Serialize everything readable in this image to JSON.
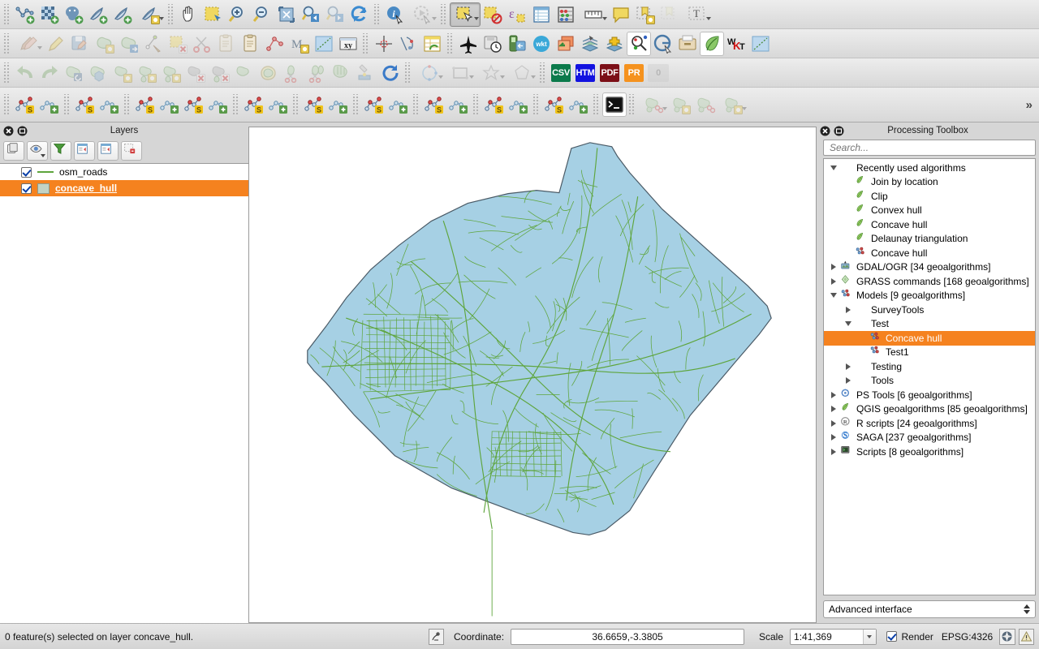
{
  "toolbars": {
    "row1": [
      {
        "name": "add-vector-layer-button",
        "icon": "vector-add-icon",
        "disabled": false
      },
      {
        "name": "add-raster-layer-button",
        "icon": "raster-add-icon",
        "disabled": false
      },
      {
        "name": "add-postgis-layer-button",
        "icon": "postgis-add-icon",
        "disabled": false
      },
      {
        "name": "add-spatialite-layer-button",
        "icon": "spatialite-add-icon",
        "disabled": false
      },
      {
        "name": "add-mssql-layer-button",
        "icon": "mssql-add-icon",
        "disabled": false
      },
      {
        "name": "new-shapefile-layer-button",
        "icon": "new-layer-icon",
        "disabled": false,
        "menu": true
      },
      {
        "name": "pan-map-button",
        "icon": "pan-hand-icon",
        "disabled": false
      },
      {
        "name": "pan-to-selection-button",
        "icon": "pan-selection-icon",
        "disabled": false
      },
      {
        "name": "zoom-in-button",
        "icon": "zoom-in-icon",
        "disabled": false
      },
      {
        "name": "zoom-out-button",
        "icon": "zoom-out-icon",
        "disabled": false
      },
      {
        "name": "zoom-full-button",
        "icon": "zoom-full-icon",
        "disabled": false
      },
      {
        "name": "zoom-last-button",
        "icon": "zoom-last-icon",
        "disabled": false
      },
      {
        "name": "zoom-next-button",
        "icon": "zoom-next-icon",
        "disabled": true
      },
      {
        "name": "refresh-button",
        "icon": "refresh-icon",
        "disabled": false
      },
      {
        "name": "identify-features-button",
        "icon": "identify-icon",
        "disabled": false
      },
      {
        "name": "run-feature-action-button",
        "icon": "feature-action-icon",
        "disabled": true,
        "menu": true
      },
      {
        "name": "select-features-button",
        "icon": "select-rect-icon",
        "disabled": false,
        "active": true,
        "menu": true
      },
      {
        "name": "deselect-features-button",
        "icon": "deselect-icon",
        "disabled": false
      },
      {
        "name": "select-by-expression-button",
        "icon": "expression-select-icon",
        "disabled": false
      },
      {
        "name": "open-attribute-table-button",
        "icon": "attribute-table-icon",
        "disabled": false
      },
      {
        "name": "open-field-calculator-button",
        "icon": "abacus-icon",
        "disabled": false
      },
      {
        "name": "measure-line-button",
        "icon": "ruler-icon",
        "disabled": false,
        "menu": true
      },
      {
        "name": "map-tips-button",
        "icon": "map-tip-icon",
        "disabled": false
      },
      {
        "name": "new-bookmark-button",
        "icon": "bookmark-new-icon",
        "disabled": false
      },
      {
        "name": "show-bookmarks-button",
        "icon": "bookmark-show-icon",
        "disabled": true
      },
      {
        "name": "text-annotation-button",
        "icon": "text-annotation-icon",
        "disabled": false,
        "menu": true
      }
    ],
    "row2": [
      {
        "name": "current-edits-button",
        "icon": "pencils-icon",
        "disabled": true,
        "menu": true
      },
      {
        "name": "toggle-editing-button",
        "icon": "pencil-icon",
        "disabled": true
      },
      {
        "name": "save-layer-edits-button",
        "icon": "save-edits-icon",
        "disabled": true
      },
      {
        "name": "add-feature-button",
        "icon": "add-feature-icon",
        "disabled": true
      },
      {
        "name": "move-feature-button",
        "icon": "move-feature-icon",
        "disabled": true
      },
      {
        "name": "node-tool-button",
        "icon": "node-tool-icon",
        "disabled": true
      },
      {
        "name": "delete-selected-button",
        "icon": "delete-selected-icon",
        "disabled": true
      },
      {
        "name": "cut-features-button",
        "icon": "scissors-icon",
        "disabled": true
      },
      {
        "name": "copy-features-button",
        "icon": "copy-icon",
        "disabled": true
      },
      {
        "name": "paste-features-button",
        "icon": "paste-icon",
        "disabled": false
      },
      {
        "name": "points-to-path-button",
        "icon": "points-path-icon",
        "disabled": false
      },
      {
        "name": "add-node-button",
        "icon": "mmqgis-icon",
        "disabled": false
      },
      {
        "name": "line-tool-button",
        "icon": "line-blue-icon",
        "disabled": false
      },
      {
        "name": "xy-tools-button",
        "icon": "xy-icon",
        "disabled": false
      },
      {
        "name": "crosshair-button",
        "icon": "crosshair-icon",
        "disabled": false
      },
      {
        "name": "vector-bender-button",
        "icon": "vector-bender-icon",
        "disabled": false
      },
      {
        "name": "refresh-table-button",
        "icon": "table-refresh-icon",
        "disabled": false
      },
      {
        "name": "flight-button",
        "icon": "airplane-icon",
        "disabled": false
      },
      {
        "name": "time-manager-button",
        "icon": "save-clock-icon",
        "disabled": false
      },
      {
        "name": "gps-export-button",
        "icon": "gps-export-icon",
        "disabled": false
      },
      {
        "name": "wkt-circle-button",
        "icon": "wkt-round-icon",
        "disabled": false
      },
      {
        "name": "layer-back-button",
        "icon": "layer-back-icon",
        "disabled": false
      },
      {
        "name": "stack-tool-button",
        "icon": "stack-icon",
        "disabled": false
      },
      {
        "name": "stack-add-button",
        "icon": "stack-add-icon",
        "disabled": false
      },
      {
        "name": "search-point-button",
        "icon": "search-point-icon",
        "disabled": false,
        "framed": true
      },
      {
        "name": "geocode-button",
        "icon": "geocode-icon",
        "disabled": false
      },
      {
        "name": "drawer-button",
        "icon": "drawer-icon",
        "disabled": false
      },
      {
        "name": "qgis-leaf-button",
        "icon": "leaf-icon",
        "disabled": false,
        "framed": true
      },
      {
        "name": "wkt-text-button",
        "icon": "wkt-text-icon",
        "disabled": false
      },
      {
        "name": "line-blue2-button",
        "icon": "line-blue-icon",
        "disabled": false
      }
    ],
    "row3": [
      {
        "name": "undo-button",
        "icon": "undo-icon",
        "disabled": true
      },
      {
        "name": "redo-button",
        "icon": "redo-icon",
        "disabled": true
      },
      {
        "name": "rotate-feature-button",
        "icon": "rotate-feature-icon",
        "disabled": true
      },
      {
        "name": "simplify-feature-button",
        "icon": "simplify-icon",
        "disabled": true
      },
      {
        "name": "add-ring-button",
        "icon": "add-ring-icon",
        "disabled": true
      },
      {
        "name": "add-part-button",
        "icon": "add-part-icon",
        "disabled": true
      },
      {
        "name": "fill-ring-button",
        "icon": "fill-ring-icon",
        "disabled": true
      },
      {
        "name": "delete-ring-button",
        "icon": "delete-ring-icon",
        "disabled": true
      },
      {
        "name": "delete-part-button",
        "icon": "delete-part-icon",
        "disabled": true
      },
      {
        "name": "reshape-features-button",
        "icon": "reshape-icon",
        "disabled": true
      },
      {
        "name": "offset-curve-button",
        "icon": "offset-curve-icon",
        "disabled": true
      },
      {
        "name": "split-features-button",
        "icon": "split-features-icon",
        "disabled": true
      },
      {
        "name": "split-parts-button",
        "icon": "split-parts-icon",
        "disabled": true
      },
      {
        "name": "merge-features-button",
        "icon": "merge-features-icon",
        "disabled": true
      },
      {
        "name": "merge-attributes-button",
        "icon": "merge-attributes-icon",
        "disabled": true
      },
      {
        "name": "rotate-symbol-button",
        "icon": "rotate-symbol-icon",
        "disabled": false
      },
      {
        "name": "circle-tool-button",
        "icon": "circle-tool-icon",
        "disabled": true,
        "menu": true
      },
      {
        "name": "rect-tool-button",
        "icon": "rectangle-tool-icon",
        "disabled": true,
        "menu": true
      },
      {
        "name": "star-tool-button",
        "icon": "star-tool-icon",
        "disabled": true,
        "menu": true
      },
      {
        "name": "poly-tool-button",
        "icon": "polygon-tool-icon",
        "disabled": true,
        "menu": true
      },
      {
        "name": "csv-export-button",
        "icon": "csv-badge",
        "badge": "CSV",
        "badge_color": "#0b7a4b",
        "disabled": false
      },
      {
        "name": "htm-export-button",
        "icon": "htm-badge",
        "badge": "HTM",
        "badge_color": "#1212e0",
        "disabled": false
      },
      {
        "name": "pdf-export-button",
        "icon": "pdf-badge",
        "badge": "PDF",
        "badge_color": "#7c0f17",
        "disabled": false
      },
      {
        "name": "pr-export-button",
        "icon": "pr-badge",
        "badge": "PR",
        "badge_color": "#f5921e",
        "disabled": false
      },
      {
        "name": "zero-button",
        "icon": "zero-badge",
        "badge": "0",
        "badge_color": "#c8c8c8",
        "disabled": true
      }
    ],
    "row4": [
      {
        "name": "split-line-s-button",
        "icon": "node-s-icon",
        "disabled": false
      },
      {
        "name": "split-line-add-button",
        "icon": "node-add-icon",
        "disabled": false
      },
      {
        "name": "points-s-button",
        "icon": "points-s-icon",
        "disabled": false
      },
      {
        "name": "arc-add-button",
        "icon": "arc-add-icon",
        "disabled": false
      },
      {
        "name": "vertex-s-button",
        "icon": "vertex-s-icon",
        "disabled": false
      },
      {
        "name": "vertex-add-button",
        "icon": "vertex-add-icon",
        "disabled": false
      },
      {
        "name": "segment-s-button",
        "icon": "segment-s-icon",
        "disabled": false
      },
      {
        "name": "segment-add-button",
        "icon": "segment-add-icon",
        "disabled": false
      },
      {
        "name": "link-s-button",
        "icon": "link-s-icon",
        "disabled": false
      },
      {
        "name": "link-add-button",
        "icon": "link-add-icon",
        "disabled": false
      },
      {
        "name": "az-s-button",
        "icon": "azimuth-s-icon",
        "disabled": false
      },
      {
        "name": "az-add-button",
        "icon": "azimuth-add-icon",
        "disabled": false
      },
      {
        "name": "node-red-s-button",
        "icon": "node-red-s-icon",
        "disabled": false
      },
      {
        "name": "node-red-add-button",
        "icon": "node-red-add-icon",
        "disabled": false
      },
      {
        "name": "path-s-button",
        "icon": "path-s-icon",
        "disabled": false
      },
      {
        "name": "path-add-button",
        "icon": "path-add-icon",
        "disabled": false
      },
      {
        "name": "trace-s-button",
        "icon": "trace-s-icon",
        "disabled": false
      },
      {
        "name": "trace-add-button",
        "icon": "trace-add-icon",
        "disabled": false
      },
      {
        "name": "graph-s-button",
        "icon": "graph-s-icon",
        "disabled": false
      },
      {
        "name": "graph-add-button",
        "icon": "graph-add-icon",
        "disabled": false
      },
      {
        "name": "python-console-button",
        "icon": "terminal-icon",
        "disabled": false,
        "framed": true
      },
      {
        "name": "dissolve-button",
        "icon": "dissolve-icon",
        "disabled": true,
        "menu": true
      },
      {
        "name": "buffer-button",
        "icon": "buffer-icon",
        "disabled": true
      },
      {
        "name": "simplify-geom-button",
        "icon": "simplify-geom-icon",
        "disabled": true
      },
      {
        "name": "geoprocess-button",
        "icon": "geoprocess-icon",
        "disabled": true,
        "menu": true
      }
    ],
    "overflow_label": "»"
  },
  "layers_panel": {
    "title": "Layers",
    "close_button": "close-icon",
    "undock_button": "undock-icon",
    "toolbar": [
      {
        "name": "add-group-button",
        "icon": "add-group-icon"
      },
      {
        "name": "manage-visibility-button",
        "icon": "eye-icon",
        "menu": true
      },
      {
        "name": "filter-legend-button",
        "icon": "filter-funnel-icon"
      },
      {
        "name": "expand-all-button",
        "icon": "expand-all-icon"
      },
      {
        "name": "collapse-all-button",
        "icon": "collapse-all-icon"
      },
      {
        "name": "remove-layer-button",
        "icon": "remove-layer-icon"
      }
    ],
    "items": [
      {
        "name": "osm_roads",
        "checked": true,
        "symbol": "line",
        "selected": false
      },
      {
        "name": "concave_hull",
        "checked": true,
        "symbol": "polygon",
        "selected": true
      }
    ]
  },
  "processing_toolbox": {
    "title": "Processing Toolbox",
    "close_button": "close-icon",
    "undock_button": "undock-icon",
    "search_placeholder": "Search...",
    "search_value": "",
    "tree": [
      {
        "label": "Recently used algorithms",
        "depth": 0,
        "toggle": "down",
        "icon": "none"
      },
      {
        "label": "Join by location",
        "depth": 1,
        "toggle": "none",
        "icon": "qgis-alg"
      },
      {
        "label": "Clip",
        "depth": 1,
        "toggle": "none",
        "icon": "qgis-alg"
      },
      {
        "label": "Convex hull",
        "depth": 1,
        "toggle": "none",
        "icon": "qgis-alg"
      },
      {
        "label": "Concave hull",
        "depth": 1,
        "toggle": "none",
        "icon": "qgis-alg"
      },
      {
        "label": "Delaunay triangulation",
        "depth": 1,
        "toggle": "none",
        "icon": "qgis-alg"
      },
      {
        "label": "Concave hull",
        "depth": 1,
        "toggle": "none",
        "icon": "model"
      },
      {
        "label": "GDAL/OGR [34 geoalgorithms]",
        "depth": 0,
        "toggle": "right",
        "icon": "gdal"
      },
      {
        "label": "GRASS commands [168 geoalgorithms]",
        "depth": 0,
        "toggle": "right",
        "icon": "grass"
      },
      {
        "label": "Models [9 geoalgorithms]",
        "depth": 0,
        "toggle": "down",
        "icon": "model"
      },
      {
        "label": "SurveyTools",
        "depth": 1,
        "toggle": "right",
        "icon": "none"
      },
      {
        "label": "Test",
        "depth": 1,
        "toggle": "down",
        "icon": "none"
      },
      {
        "label": "Concave hull",
        "depth": 2,
        "toggle": "none",
        "icon": "model",
        "selected": true
      },
      {
        "label": "Test1",
        "depth": 2,
        "toggle": "none",
        "icon": "model"
      },
      {
        "label": "Testing",
        "depth": 1,
        "toggle": "right",
        "icon": "none"
      },
      {
        "label": "Tools",
        "depth": 1,
        "toggle": "right",
        "icon": "none"
      },
      {
        "label": "PS Tools [6 geoalgorithms]",
        "depth": 0,
        "toggle": "right",
        "icon": "pstools"
      },
      {
        "label": "QGIS geoalgorithms [85 geoalgorithms]",
        "depth": 0,
        "toggle": "right",
        "icon": "qgis-alg"
      },
      {
        "label": "R scripts [24 geoalgorithms]",
        "depth": 0,
        "toggle": "right",
        "icon": "rscript"
      },
      {
        "label": "SAGA [237 geoalgorithms]",
        "depth": 0,
        "toggle": "right",
        "icon": "saga"
      },
      {
        "label": "Scripts [8 geoalgorithms]",
        "depth": 0,
        "toggle": "right",
        "icon": "script"
      }
    ],
    "interface_mode": "Advanced interface"
  },
  "map": {
    "hull_fill": "#a6d0e4",
    "hull_stroke": "#4a5a66",
    "road_stroke": "#5ea53c",
    "background": "#ffffff"
  },
  "status_bar": {
    "message": "0 feature(s) selected on layer concave_hull.",
    "coordinate_icon": "coordinate-toggle-icon",
    "coordinate_label": "Coordinate:",
    "coordinate_value": "36.6659,-3.3805",
    "scale_label": "Scale",
    "scale_value": "1:41,369",
    "render_label": "Render",
    "render_checked": true,
    "crs_label": "EPSG:4326",
    "crs_button": "crs-status-icon",
    "messages_button": "messages-warning-icon"
  }
}
